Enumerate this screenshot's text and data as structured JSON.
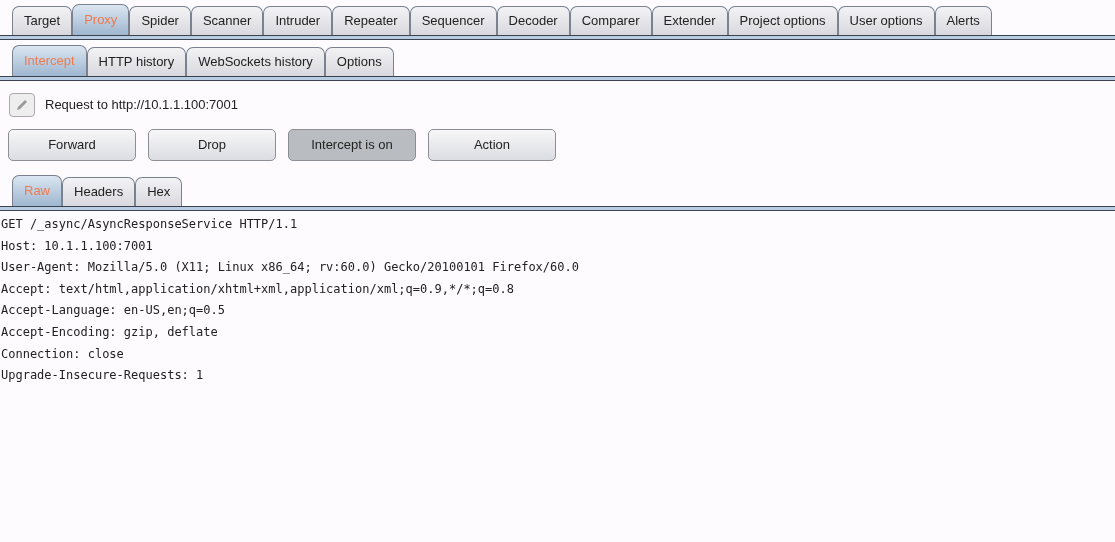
{
  "main_tabs": [
    {
      "label": "Target",
      "selected": false
    },
    {
      "label": "Proxy",
      "selected": true
    },
    {
      "label": "Spider",
      "selected": false
    },
    {
      "label": "Scanner",
      "selected": false
    },
    {
      "label": "Intruder",
      "selected": false
    },
    {
      "label": "Repeater",
      "selected": false
    },
    {
      "label": "Sequencer",
      "selected": false
    },
    {
      "label": "Decoder",
      "selected": false
    },
    {
      "label": "Comparer",
      "selected": false
    },
    {
      "label": "Extender",
      "selected": false
    },
    {
      "label": "Project options",
      "selected": false
    },
    {
      "label": "User options",
      "selected": false
    },
    {
      "label": "Alerts",
      "selected": false
    }
  ],
  "proxy_tabs": [
    {
      "label": "Intercept",
      "selected": true
    },
    {
      "label": "HTTP history",
      "selected": false
    },
    {
      "label": "WebSockets history",
      "selected": false
    },
    {
      "label": "Options",
      "selected": false
    }
  ],
  "request_label": "Request to http://10.1.1.100:7001",
  "buttons": [
    {
      "label": "Forward",
      "pressed": false
    },
    {
      "label": "Drop",
      "pressed": false
    },
    {
      "label": "Intercept is on",
      "pressed": true
    },
    {
      "label": "Action",
      "pressed": false
    }
  ],
  "view_tabs": [
    {
      "label": "Raw",
      "selected": true
    },
    {
      "label": "Headers",
      "selected": false
    },
    {
      "label": "Hex",
      "selected": false
    }
  ],
  "request_lines": [
    "GET /_async/AsyncResponseService HTTP/1.1",
    "Host: 10.1.1.100:7001",
    "User-Agent: Mozilla/5.0 (X11; Linux x86_64; rv:60.0) Gecko/20100101 Firefox/60.0",
    "Accept: text/html,application/xhtml+xml,application/xml;q=0.9,*/*;q=0.8",
    "Accept-Language: en-US,en;q=0.5",
    "Accept-Encoding: gzip, deflate",
    "Connection: close",
    "Upgrade-Insecure-Requests: 1"
  ]
}
